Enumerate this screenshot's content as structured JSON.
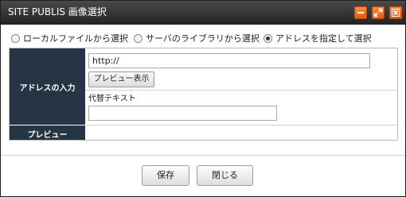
{
  "window": {
    "title": "SITE PUBLIS 画像選択",
    "controls": {
      "minimize_icon": "minimize-icon",
      "maximize_icon": "maximize-icon",
      "close_icon": "close-icon",
      "accent_color": "#f26b1d",
      "titlebar_color": "#2c2c2c"
    }
  },
  "source_options": [
    {
      "label": "ローカルファイルから選択",
      "checked": false
    },
    {
      "label": "サーバのライブラリから選択",
      "checked": false
    },
    {
      "label": "アドレスを指定して選択",
      "checked": true
    }
  ],
  "form": {
    "header_color": "#263543",
    "address_row": {
      "label": "アドレスの入力",
      "url_value": "http://",
      "preview_button": "プレビュー表示",
      "alt_text_label": "代替テキスト",
      "alt_text_value": ""
    },
    "preview_row": {
      "label": "プレビュー"
    }
  },
  "footer": {
    "save_button": "保存",
    "close_button": "閉じる"
  }
}
